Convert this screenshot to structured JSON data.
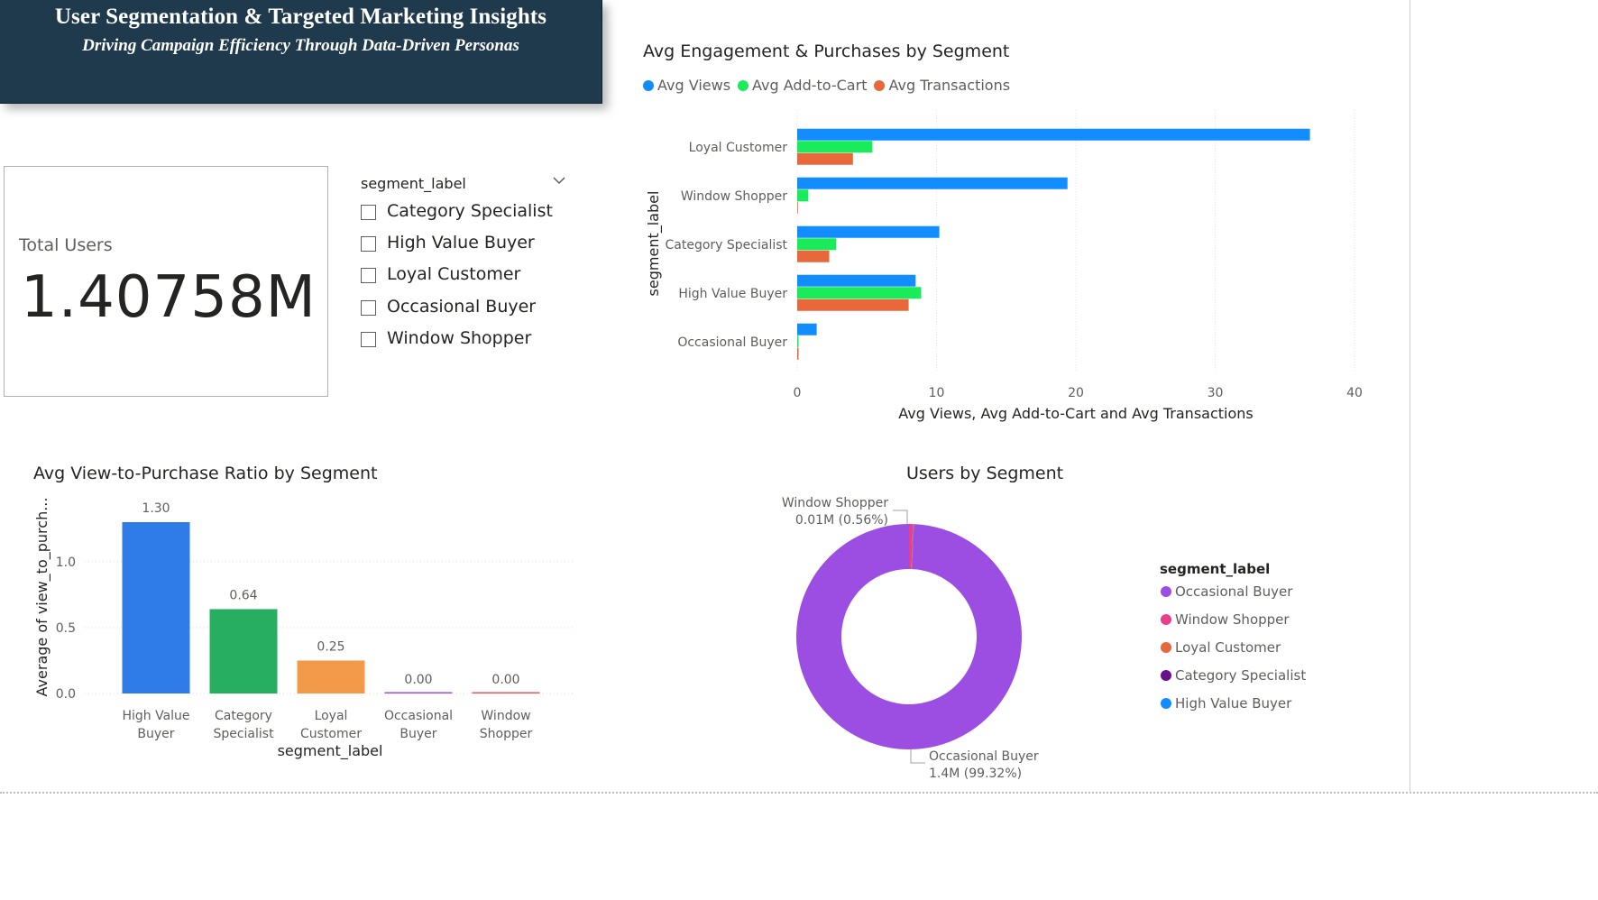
{
  "header": {
    "title": "User Segmentation & Targeted Marketing Insights",
    "subtitle": "Driving Campaign Efficiency Through Data-Driven Personas"
  },
  "card": {
    "label": "Total Users",
    "value": "1.40758M"
  },
  "slicer": {
    "title": "segment_label",
    "items": [
      "Category Specialist",
      "High Value Buyer",
      "Loyal Customer",
      "Occasional Buyer",
      "Window Shopper"
    ]
  },
  "chart_data": [
    {
      "type": "bar",
      "orientation": "horizontal",
      "title": "Avg Engagement & Purchases by Segment",
      "xlabel": "Avg Views, Avg Add-to-Cart and Avg Transactions",
      "ylabel": "segment_label",
      "xlim": [
        0,
        40
      ],
      "xticks": [
        "0",
        "10",
        "20",
        "30",
        "40"
      ],
      "grid": true,
      "legend_position": "top-left",
      "categories": [
        "Loyal Customer",
        "Window Shopper",
        "Category Specialist",
        "High Value Buyer",
        "Occasional Buyer"
      ],
      "series": [
        {
          "name": "Avg Views",
          "color": "#118dff",
          "values": [
            36.8,
            19.4,
            10.2,
            8.5,
            1.4
          ]
        },
        {
          "name": "Avg Add-to-Cart",
          "color": "#1aeb5a",
          "values": [
            5.4,
            0.8,
            2.8,
            8.9,
            0.1
          ]
        },
        {
          "name": "Avg Transactions",
          "color": "#e8683c",
          "values": [
            4.0,
            0.0,
            2.3,
            8.0,
            0.1
          ]
        }
      ]
    },
    {
      "type": "bar",
      "title": "Avg View-to-Purchase Ratio by Segment",
      "xlabel": "segment_label",
      "ylabel": "Average of view_to_purch...",
      "ylim": [
        0,
        1.3
      ],
      "yticks": [
        "0.0",
        "0.5",
        "1.0"
      ],
      "grid": true,
      "categories": [
        [
          "High Value",
          "Buyer"
        ],
        [
          "Category",
          "Specialist"
        ],
        [
          "Loyal",
          "Customer"
        ],
        [
          "Occasional",
          "Buyer"
        ],
        [
          "Window",
          "Shopper"
        ]
      ],
      "values": [
        1.3,
        0.64,
        0.25,
        0.0,
        0.0
      ],
      "labels": [
        "1.30",
        "0.64",
        "0.25",
        "0.00",
        "0.00"
      ],
      "colors": [
        "#2f7be8",
        "#27ae60",
        "#f2994a",
        "#9b51e0",
        "#eb5757"
      ]
    },
    {
      "type": "pie",
      "donut": true,
      "title": "Users by Segment",
      "legend_title": "segment_label",
      "legend_position": "right",
      "slices": [
        {
          "label": "Occasional Buyer",
          "value": 99.32,
          "color": "#9c4ee3",
          "data_label": [
            "Occasional Buyer",
            "1.4M (99.32%)"
          ]
        },
        {
          "label": "Window Shopper",
          "value": 0.56,
          "color": "#e83e8c",
          "data_label": [
            "Window Shopper",
            "0.01M (0.56%)"
          ]
        },
        {
          "label": "Loyal Customer",
          "value": 0.06,
          "color": "#e8683c"
        },
        {
          "label": "Category Specialist",
          "value": 0.04,
          "color": "#6a0f8e"
        },
        {
          "label": "High Value Buyer",
          "value": 0.02,
          "color": "#118dff"
        }
      ]
    }
  ]
}
